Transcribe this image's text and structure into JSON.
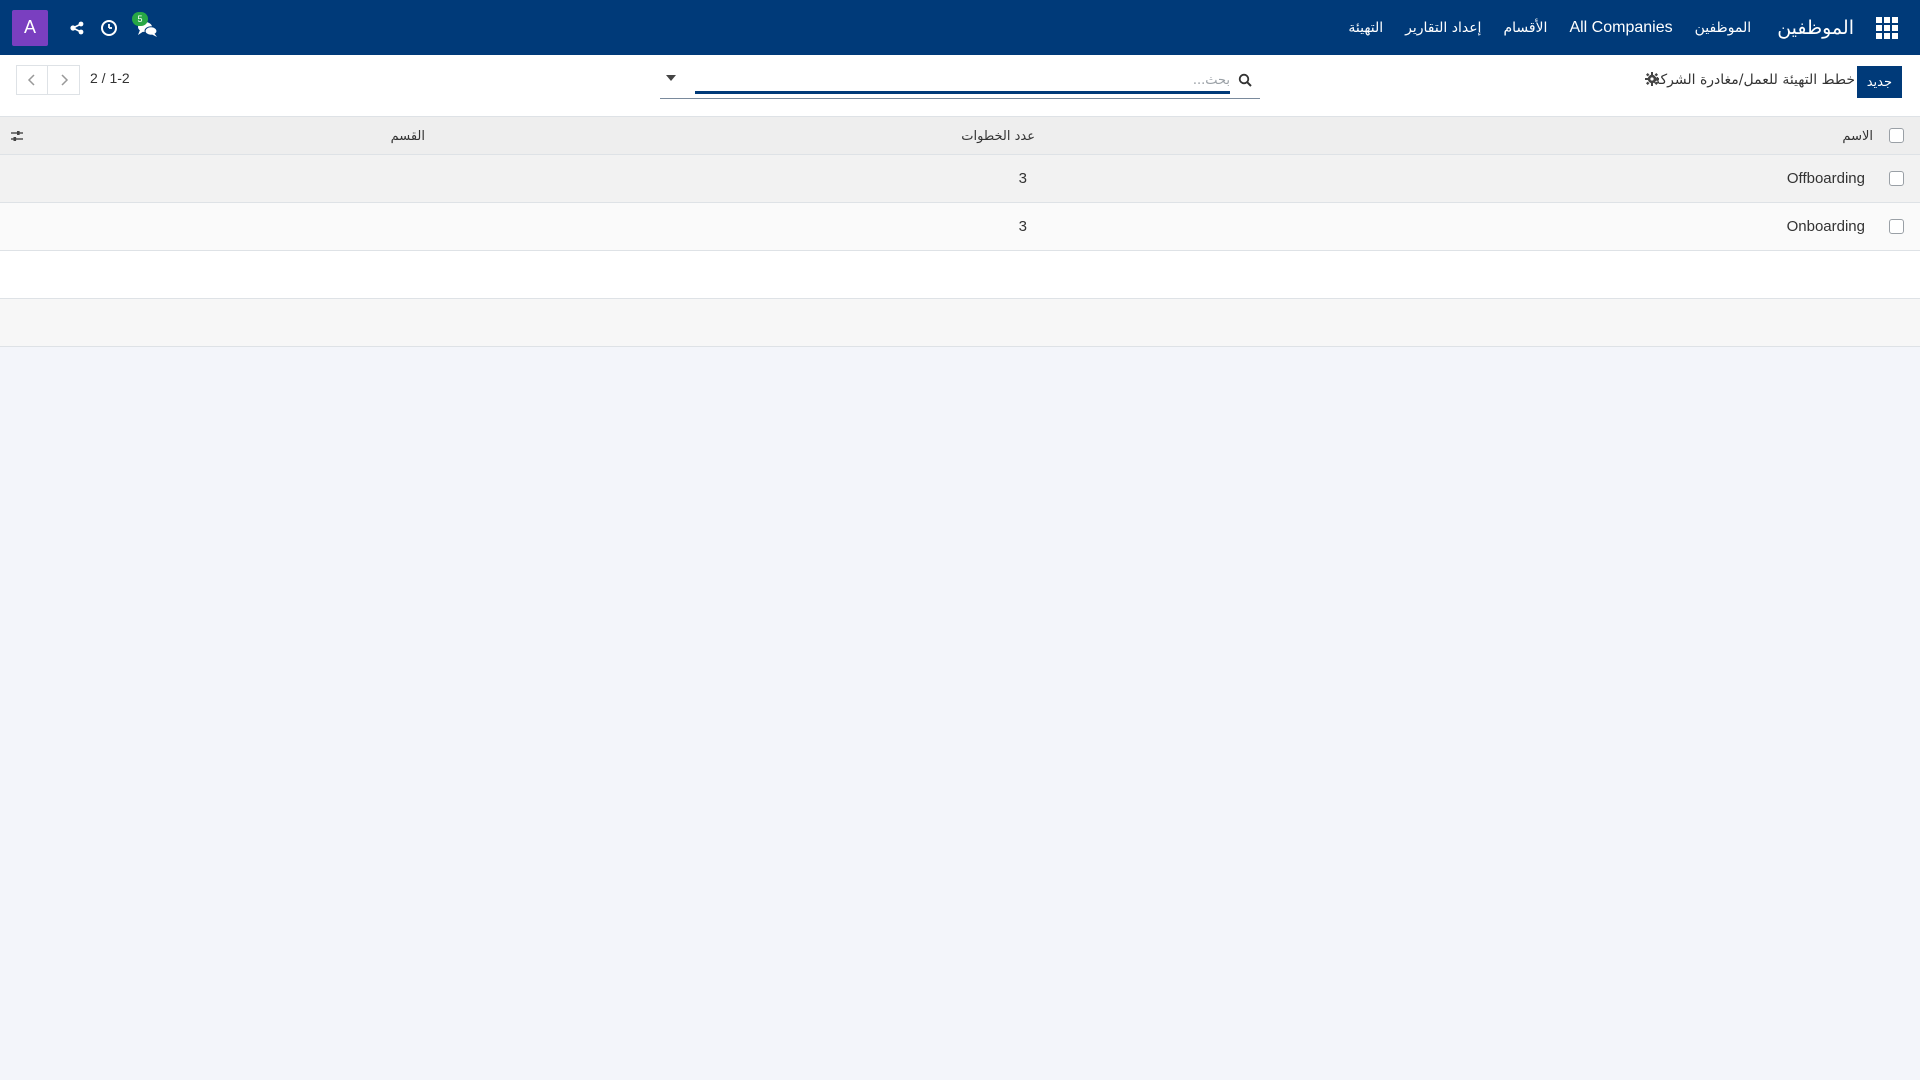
{
  "navbar": {
    "app_title": "الموظفين",
    "menu": [
      "الموظفين",
      "All Companies",
      "الأقسام",
      "إعداد التقارير",
      "التهيئة"
    ],
    "avatar_letter": "A",
    "chat_badge": "5",
    "background_color": "#003a79"
  },
  "control_panel": {
    "new_label": "جديد",
    "breadcrumb": "خطط التهيئة للعمل/مغادرة الشركة",
    "search_placeholder": "بحث...",
    "pager_text": "1-2 / 2"
  },
  "list": {
    "columns": [
      "الاسم",
      "عدد الخطوات",
      "القسم"
    ],
    "rows": [
      {
        "name": "Offboarding",
        "steps": "3",
        "department": ""
      },
      {
        "name": "Onboarding",
        "steps": "3",
        "department": ""
      }
    ]
  },
  "icons": {
    "apps": "apps-grid-icon",
    "share": "share-icon",
    "clock": "clock-icon",
    "chat": "chat-icon",
    "gear": "gear-icon",
    "search": "search-icon",
    "column_settings": "sliders-icon"
  }
}
